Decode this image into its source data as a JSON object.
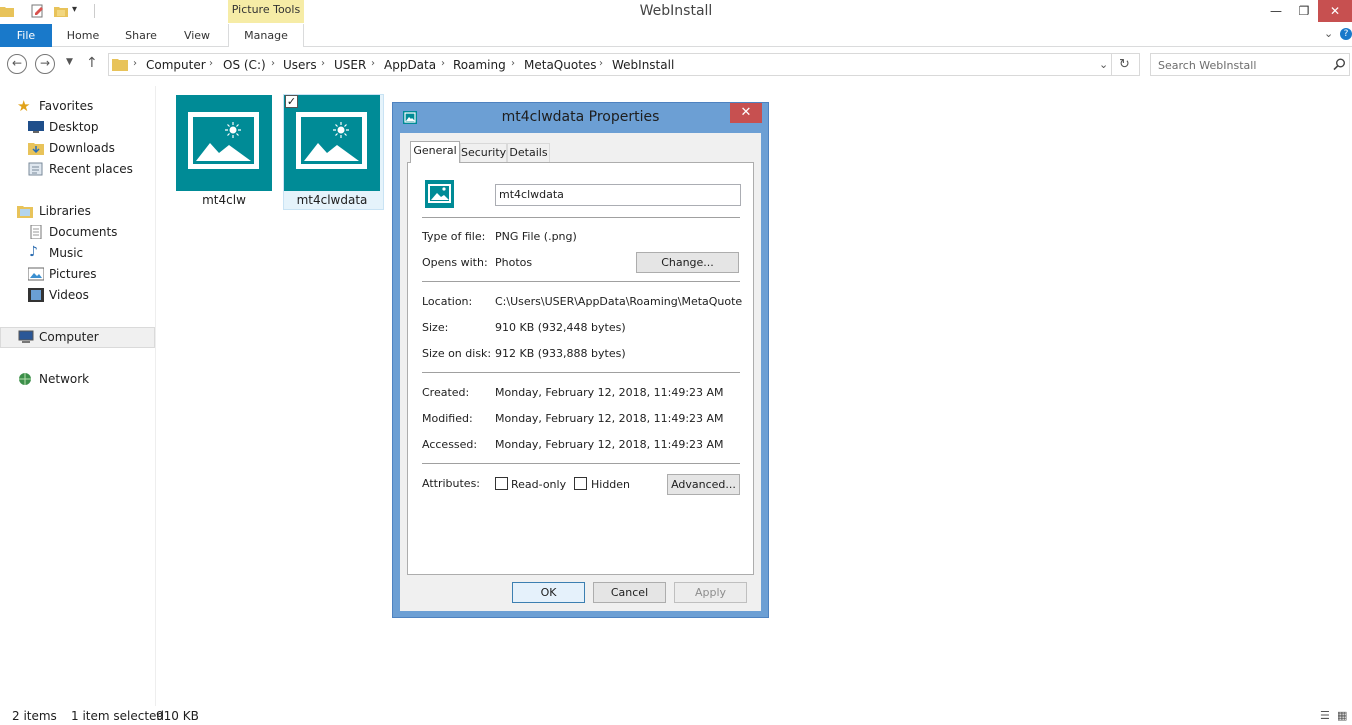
{
  "window": {
    "title": "WebInstall",
    "context_tab": "Picture Tools"
  },
  "ribbon": {
    "tabs": [
      "File",
      "Home",
      "Share",
      "View",
      "Manage"
    ]
  },
  "address": {
    "breadcrumbs": [
      "Computer",
      "OS (C:)",
      "Users",
      "USER",
      "AppData",
      "Roaming",
      "MetaQuotes",
      "WebInstall"
    ]
  },
  "search": {
    "placeholder": "Search WebInstall"
  },
  "nav": {
    "favorites": "Favorites",
    "desktop": "Desktop",
    "downloads": "Downloads",
    "recent": "Recent places",
    "libraries": "Libraries",
    "documents": "Documents",
    "music": "Music",
    "pictures": "Pictures",
    "videos": "Videos",
    "computer": "Computer",
    "network": "Network"
  },
  "files": [
    {
      "name": "mt4clw",
      "selected": false
    },
    {
      "name": "mt4clwdata",
      "selected": true
    }
  ],
  "status": {
    "items": "2 items",
    "selected": "1 item selected",
    "size": "910 KB"
  },
  "dialog": {
    "title": "mt4clwdata Properties",
    "close_glyph": "✕",
    "tabs": {
      "general": "General",
      "security": "Security",
      "details": "Details"
    },
    "filename": "mt4clwdata",
    "type_label": "Type of file:",
    "type_value": "PNG File (.png)",
    "opens_label": "Opens with:",
    "opens_value": "Photos",
    "change_btn": "Change...",
    "location_label": "Location:",
    "location_value": "C:\\Users\\USER\\AppData\\Roaming\\MetaQuotes\\W",
    "size_label": "Size:",
    "size_value": "910 KB (932,448 bytes)",
    "sizedisk_label": "Size on disk:",
    "sizedisk_value": "912 KB (933,888 bytes)",
    "created_label": "Created:",
    "created_value": "Monday, February 12, 2018, 11:49:23 AM",
    "modified_label": "Modified:",
    "modified_value": "Monday, February 12, 2018, 11:49:23 AM",
    "accessed_label": "Accessed:",
    "accessed_value": "Monday, February 12, 2018, 11:49:23 AM",
    "attributes_label": "Attributes:",
    "readonly_label": "Read-only",
    "readonly_checked": false,
    "hidden_label": "Hidden",
    "hidden_checked": false,
    "advanced_btn": "Advanced...",
    "ok_btn": "OK",
    "cancel_btn": "Cancel",
    "apply_btn": "Apply"
  },
  "colors": {
    "accent": "#1979ca",
    "thumb": "#008b96",
    "dialog_frame": "#6c9fd4",
    "close_red": "#c75050",
    "context_tab": "#f6eca6"
  }
}
